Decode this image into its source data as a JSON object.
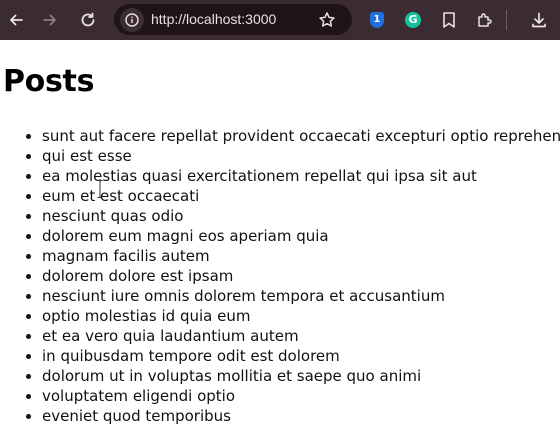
{
  "browser": {
    "url": "http://localhost:3000",
    "toolbar_bg": "#3b2b33",
    "icons": [
      "back-icon",
      "forward-icon",
      "reload-icon",
      "site-info-icon",
      "bookmark-star-icon",
      "password-extension-icon",
      "grammarly-extension-icon",
      "reading-list-icon",
      "extensions-puzzle-icon",
      "download-icon"
    ],
    "password_badge": "1",
    "grammarly_badge": "G"
  },
  "page": {
    "title": "Posts",
    "posts": [
      "sunt aut facere repellat provident occaecati excepturi optio reprehenderit",
      "qui est esse",
      "ea molestias quasi exercitationem repellat qui ipsa sit aut",
      "eum et est occaecati",
      "nesciunt quas odio",
      "dolorem eum magni eos aperiam quia",
      "magnam facilis autem",
      "dolorem dolore est ipsam",
      "nesciunt iure omnis dolorem tempora et accusantium",
      "optio molestias id quia eum",
      "et ea vero quia laudantium autem",
      "in quibusdam tempore odit est dolorem",
      "dolorum ut in voluptas mollitia et saepe quo animi",
      "voluptatem eligendi optio",
      "eveniet quod temporibus"
    ]
  }
}
